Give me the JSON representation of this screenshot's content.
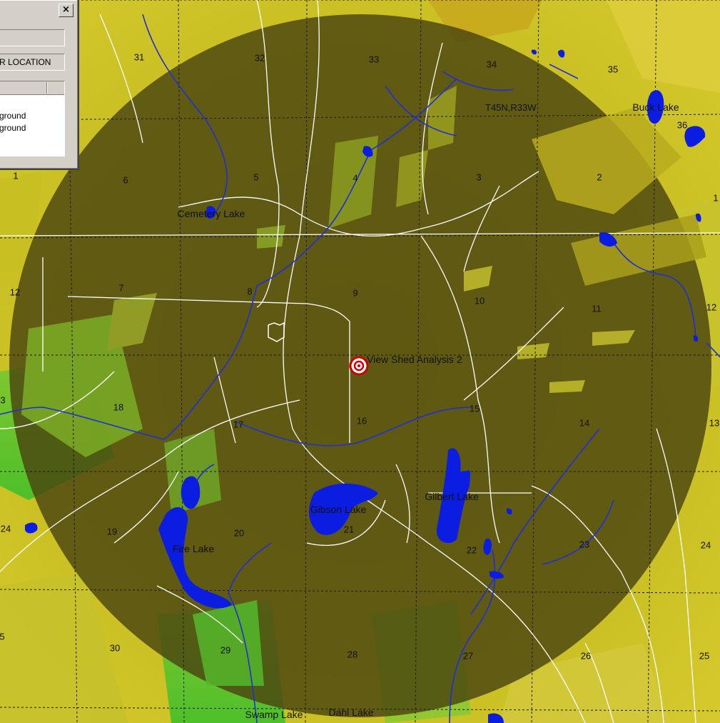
{
  "dialog": {
    "close_glyph": "×",
    "field_1_value": "",
    "field_2_value": "R LOCATION",
    "list_rows": [
      "ground",
      "ground"
    ]
  },
  "map": {
    "target_label": "View Shed Analysis 2",
    "township_label": "T45N,R33W",
    "sections": {
      "s31": "31",
      "s32": "32",
      "s33": "33",
      "s34": "34",
      "s35": "35",
      "s36": "36",
      "s1_left": "1",
      "s6": "6",
      "s5": "5",
      "s4": "4",
      "s3": "3",
      "s2": "2",
      "s1_right": "1",
      "s12_left": "12",
      "s7": "7",
      "s8": "8",
      "s9": "9",
      "s10": "10",
      "s11": "11",
      "s12_right": "12",
      "s13_left": "3",
      "s18": "18",
      "s17": "17",
      "s16": "16",
      "s15": "15",
      "s14": "14",
      "s13_right": "13",
      "s24_left": "24",
      "s19": "19",
      "s20": "20",
      "s21": "21",
      "s22": "22",
      "s23": "23",
      "s24_right": "24",
      "s25_left": "5",
      "s30": "30",
      "s29": "29",
      "s28": "28",
      "s27": "27",
      "s26": "26",
      "s25": "25"
    },
    "lakes": {
      "cemetery": "Cemetery Lake",
      "buck": "Buck Lake",
      "gibson": "Gibson Lake",
      "gilbert": "Gilbert Lake",
      "fire": "Fire Lake",
      "swamp": "Swamp Lake",
      "dahl": "Dahl Lake"
    },
    "colors": {
      "viewshed": "#4a4410",
      "terrain_yellow": "#d7c81e",
      "terrain_green": "#58c82a",
      "water": "#0a1de0",
      "roads": "#ffffff",
      "grid": "#1a1a1a"
    }
  }
}
